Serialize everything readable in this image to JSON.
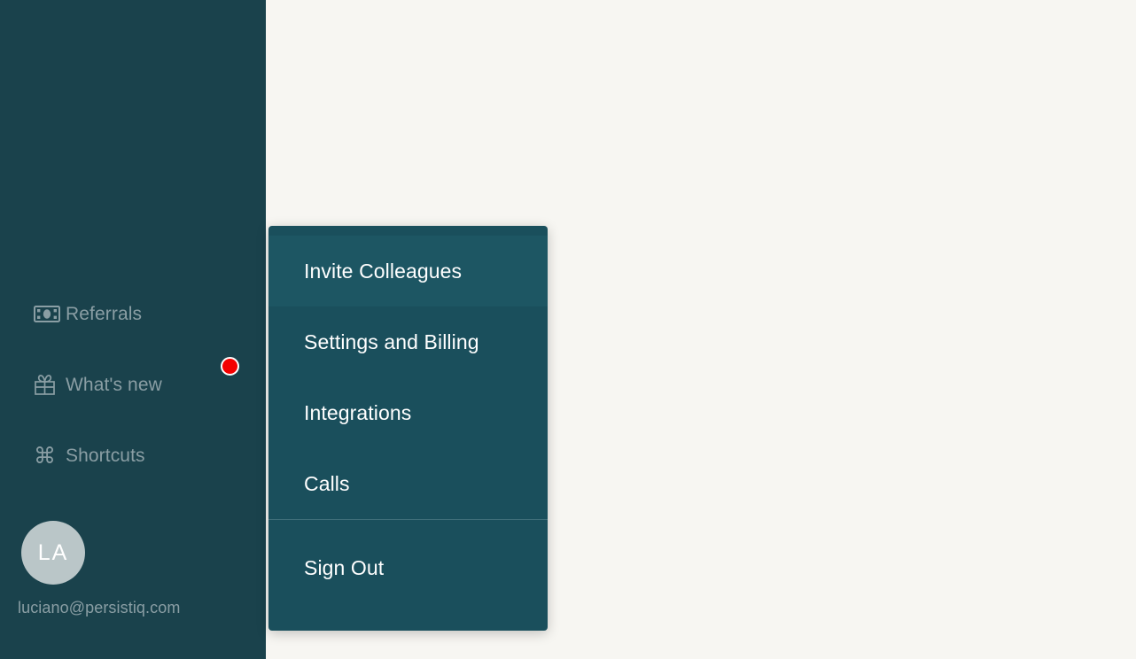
{
  "colors": {
    "page_background": "#f7f6f2",
    "sidebar_background": "#1a424c",
    "dropdown_background": "#1a4f5c",
    "dropdown_active": "#1d5663",
    "sidebar_text": "#8a9ea4",
    "menu_text": "#ffffff",
    "badge": "#f40000",
    "avatar": "#bac6c8",
    "divider": "#3f6e79"
  },
  "sidebar": {
    "items": [
      {
        "id": "referrals",
        "label": "Referrals",
        "icon": "banknote-icon",
        "badge": false
      },
      {
        "id": "whatsnew",
        "label": "What's new",
        "icon": "gift-icon",
        "badge": true
      },
      {
        "id": "shortcuts",
        "label": "Shortcuts",
        "icon": "command-icon",
        "badge": false
      }
    ],
    "user": {
      "avatar_initials": "LA",
      "email": "luciano@persistiq.com"
    }
  },
  "dropdown": {
    "items": [
      {
        "id": "invite-colleagues",
        "label": "Invite Colleagues",
        "active": true
      },
      {
        "id": "settings-and-billing",
        "label": "Settings and Billing",
        "active": false
      },
      {
        "id": "integrations",
        "label": "Integrations",
        "active": false
      },
      {
        "id": "calls",
        "label": "Calls",
        "active": false
      }
    ],
    "footer_items": [
      {
        "id": "sign-out",
        "label": "Sign Out",
        "active": false
      }
    ]
  }
}
